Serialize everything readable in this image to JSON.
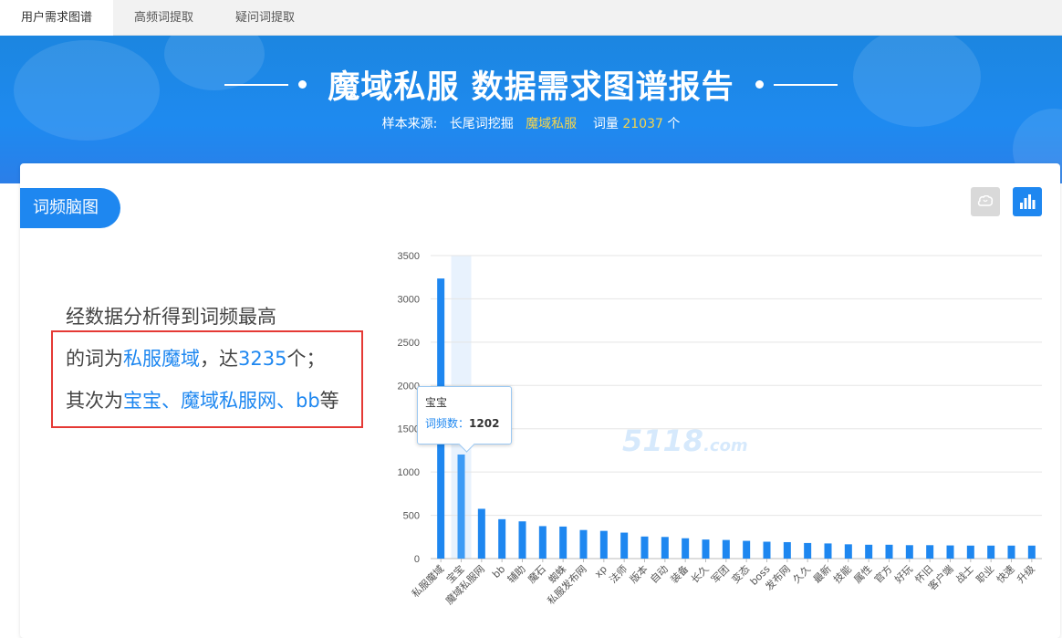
{
  "tabs": [
    {
      "label": "用户需求图谱",
      "active": true
    },
    {
      "label": "高频词提取",
      "active": false
    },
    {
      "label": "疑问词提取",
      "active": false
    }
  ],
  "banner": {
    "title": "魔域私服 数据需求图谱报告",
    "source_label": "样本来源:",
    "source_value": "长尾词挖掘",
    "keyword": "魔域私服",
    "count_label": "词量",
    "count_value": "21037",
    "count_unit": "个"
  },
  "card": {
    "label": "词频脑图",
    "icons": [
      "brain-icon",
      "bar-chart-icon"
    ]
  },
  "summary": {
    "line1": "经数据分析得到词频最高",
    "line2_a": "的词为",
    "line2_word": "私服魔域",
    "line2_b": "，达",
    "line2_num": "3235",
    "line2_c": "个；",
    "line3_a": "其次为",
    "line3_words": "宝宝、魔域私服网、bb",
    "line3_b": "等"
  },
  "tooltip": {
    "name": "宝宝",
    "label": "词频数：",
    "value": "1202"
  },
  "watermark": {
    "text": "5118",
    "suffix": ".com"
  },
  "colors": {
    "accent": "#1e87f0",
    "bar": "#1e87f0",
    "highlight_bar": "#3d9bf5",
    "box": "#e53935"
  },
  "chart_data": {
    "type": "bar",
    "categories": [
      "私服魔域",
      "宝宝",
      "魔域私服网",
      "bb",
      "辅助",
      "魔石",
      "蜘蛛",
      "私服发布网",
      "xp",
      "法师",
      "版本",
      "自动",
      "装备",
      "长久",
      "军团",
      "变态",
      "boss",
      "发布网",
      "久久",
      "最新",
      "技能",
      "属性",
      "官方",
      "好玩",
      "怀旧",
      "客户端",
      "战士",
      "职业",
      "快速",
      "升级"
    ],
    "values": [
      3235,
      1202,
      575,
      455,
      430,
      375,
      370,
      330,
      320,
      300,
      255,
      250,
      235,
      220,
      215,
      205,
      195,
      190,
      180,
      175,
      165,
      160,
      160,
      155,
      155,
      152,
      150,
      150,
      150,
      150
    ],
    "ylim": [
      0,
      3500
    ],
    "yticks": [
      0,
      500,
      1000,
      1500,
      2000,
      2500,
      3000,
      3500
    ],
    "highlight_index": 1,
    "grid": true
  }
}
